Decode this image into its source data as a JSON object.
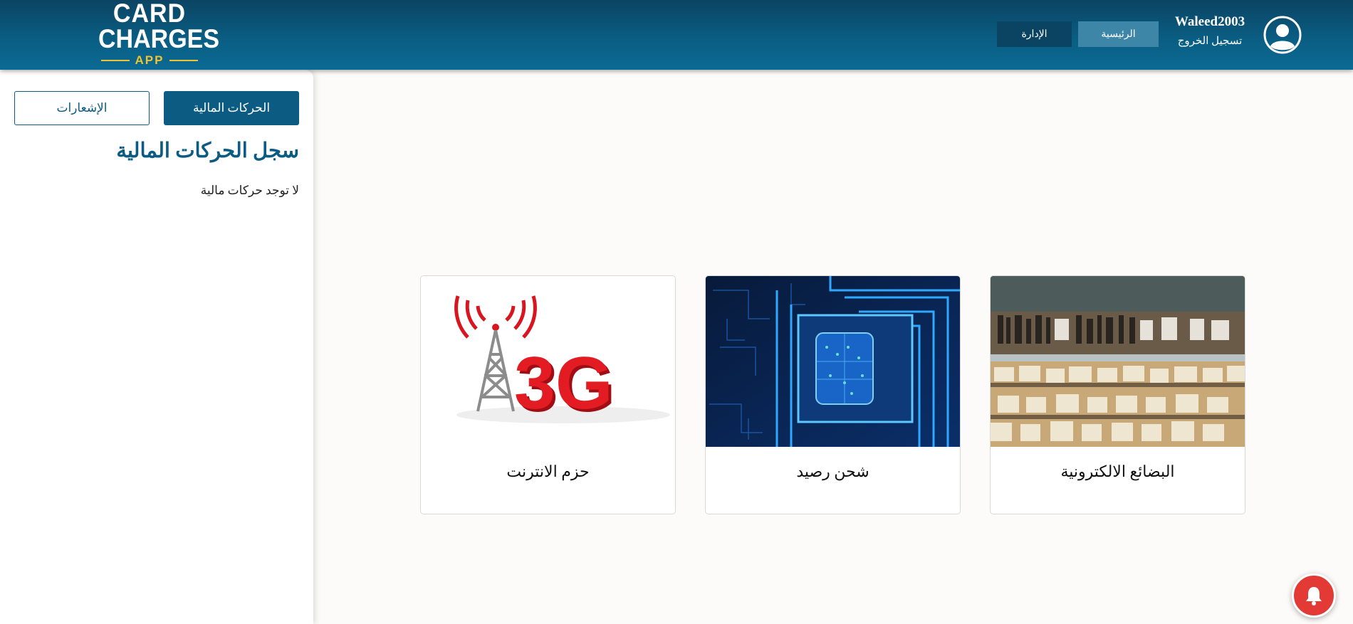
{
  "header": {
    "logo": {
      "line1": "CARD",
      "line2": "CHARGES",
      "line3": "APP"
    },
    "nav": {
      "admin_label": "الإدارة",
      "home_label": "الرئيسية"
    },
    "user": {
      "name": "Waleed2003",
      "logout_label": "تسجيل الخروج"
    }
  },
  "sidebar": {
    "tabs": {
      "transactions_label": "الحركات المالية",
      "notifications_label": "الإشعارات"
    },
    "title": "سجل الحركات المالية",
    "empty_message": "لا توجد حركات مالية"
  },
  "cards": [
    {
      "label": "البضائع الالكترونية",
      "image": "record-store-photo"
    },
    {
      "label": "شحن رصيد",
      "image": "sim-chip-circuit-photo"
    },
    {
      "label": "حزم الانترنت",
      "image": "3g-tower-image"
    }
  ],
  "image_text": {
    "network": "3G"
  },
  "colors": {
    "header_dark": "#0b4463",
    "header_light": "#0b6a93",
    "accent": "#0b5b82",
    "logo_yellow": "#f1c232",
    "notification": "#e33a36"
  }
}
